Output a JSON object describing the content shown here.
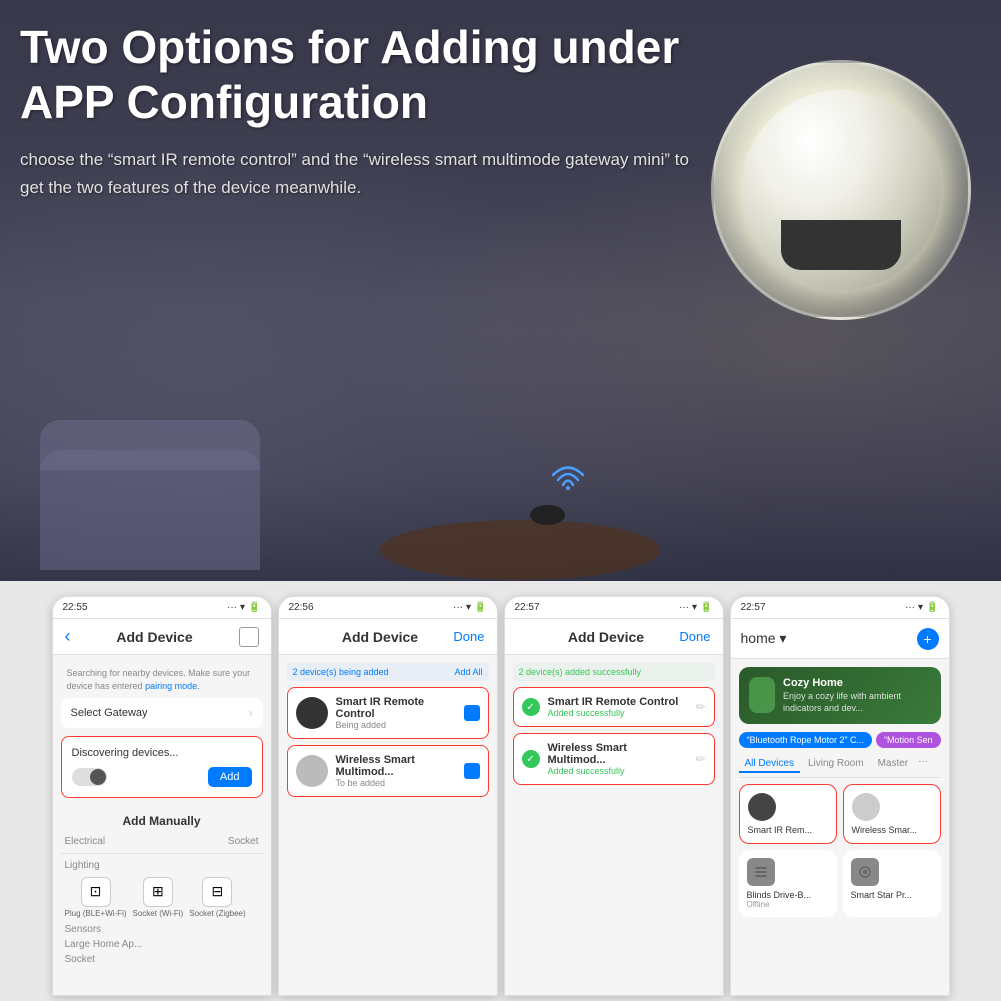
{
  "page": {
    "title": "Two Options for Adding under APP Configuration",
    "subtitle": "choose the “smart IR remote control” and the “wireless smart multimode gateway mini” to get the two features of the device meanwhile."
  },
  "phone1": {
    "time": "22:55",
    "title": "Add Device",
    "search_text": "Searching for nearby devices. Make sure your device has entered",
    "pairing_link": "pairing mode.",
    "select_gateway": "Select Gateway",
    "discovering": "Discovering devices...",
    "add_label": "Add",
    "add_manually": "Add Manually",
    "electrical": "Electrical",
    "socket": "Socket",
    "lighting": "Lighting",
    "sensors": "Sensors",
    "large_home": "Large Home Ap...",
    "plug_label": "Plug (BLE+Wi-Fi)",
    "socket_wifi": "Socket (Wi-Fi)",
    "socket_zigbee": "Socket (Zigbee)"
  },
  "phone2": {
    "time": "22:56",
    "title": "Add Device",
    "done_label": "Done",
    "being_added_text": "2 device(s) being added",
    "add_all_label": "Add All",
    "device1_name": "Smart IR Remote Control",
    "device1_status": "Being added",
    "device2_name": "Wireless Smart Multimod...",
    "device2_status": "To be added"
  },
  "phone3": {
    "time": "22:57",
    "title": "Add Device",
    "done_label": "Done",
    "added_text": "2 device(s) added successfully",
    "device1_name": "Smart IR Remote Control",
    "device1_status": "Added successfully",
    "device2_name": "Wireless Smart Multimod...",
    "device2_status": "Added successfully"
  },
  "phone4": {
    "time": "22:57",
    "home_label": "home ▾",
    "cozy_title": "Cozy Home",
    "cozy_desc": "Enjoy a cozy life with ambient indicators and dev...",
    "tag1": "“Bluetooth Rope Motor 2” C...",
    "tag2": "“Motion Sen",
    "all_devices": "All Devices",
    "living_room": "Living Room",
    "master": "Master",
    "device1_name": "Smart IR Rem...",
    "device2_name": "Wireless Smar...",
    "device3_name": "Blinds Drive-B...",
    "device4_name": "Smart Star Pr...",
    "offline_label": "Offline"
  }
}
